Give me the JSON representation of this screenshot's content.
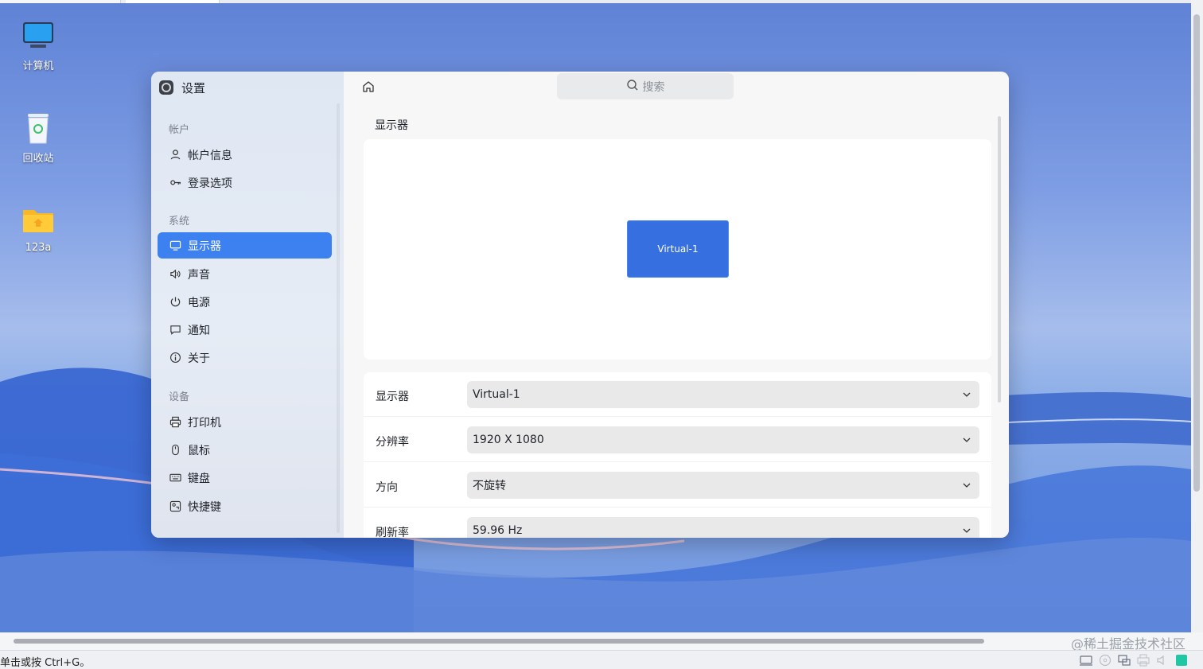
{
  "desktop": {
    "icons": [
      {
        "label": "计算机",
        "icon": "computer-icon"
      },
      {
        "label": "回收站",
        "icon": "trash-icon"
      },
      {
        "label": "123a",
        "icon": "folder-icon"
      }
    ]
  },
  "window": {
    "app_title": "设置",
    "search_placeholder": "搜索",
    "page_title": "显示器",
    "sidebar": {
      "groups": [
        {
          "label": "帐户",
          "items": [
            {
              "label": "帐户信息",
              "icon": "user-icon"
            },
            {
              "label": "登录选项",
              "icon": "key-icon"
            }
          ]
        },
        {
          "label": "系统",
          "items": [
            {
              "label": "显示器",
              "icon": "monitor-icon",
              "active": true
            },
            {
              "label": "声音",
              "icon": "speaker-icon"
            },
            {
              "label": "电源",
              "icon": "power-icon"
            },
            {
              "label": "通知",
              "icon": "notification-icon"
            },
            {
              "label": "关于",
              "icon": "info-icon"
            }
          ]
        },
        {
          "label": "设备",
          "items": [
            {
              "label": "打印机",
              "icon": "printer-icon"
            },
            {
              "label": "鼠标",
              "icon": "mouse-icon"
            },
            {
              "label": "键盘",
              "icon": "keyboard-icon"
            },
            {
              "label": "快捷键",
              "icon": "shortcut-icon"
            }
          ]
        }
      ]
    },
    "display_preview": {
      "monitor_label": "Virtual-1"
    },
    "settings": [
      {
        "label": "显示器",
        "value": "Virtual-1"
      },
      {
        "label": "分辨率",
        "value": "1920 X 1080"
      },
      {
        "label": "方向",
        "value": "不旋转"
      },
      {
        "label": "刷新率",
        "value": "59.96 Hz"
      }
    ]
  },
  "statusbar": {
    "hint": "单击或按 Ctrl+G。"
  },
  "watermark": "@稀土掘金技术社区",
  "colors": {
    "accent": "#3d80ef",
    "monitor_fill": "#3670e0"
  }
}
